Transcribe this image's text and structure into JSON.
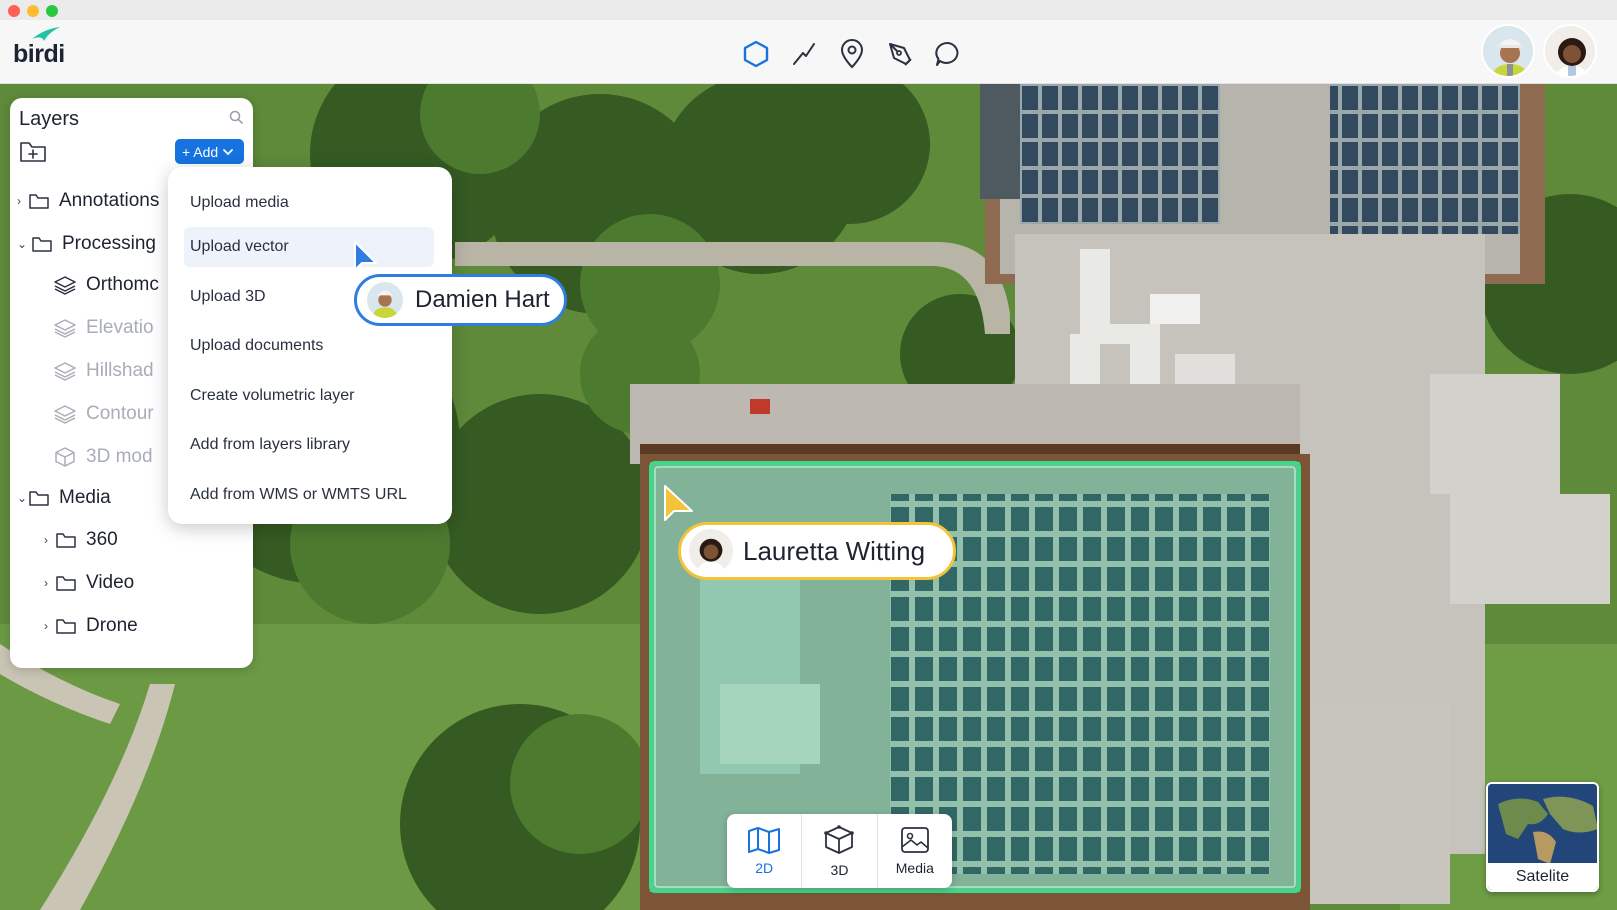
{
  "app": {
    "logo_text": "birdi"
  },
  "toolbar": {
    "tools": [
      {
        "name": "polygon-tool",
        "icon": "hexagon-icon",
        "active": true
      },
      {
        "name": "line-tool",
        "icon": "line-icon"
      },
      {
        "name": "pin-tool",
        "icon": "map-pin-icon"
      },
      {
        "name": "draw-tool",
        "icon": "pen-icon"
      },
      {
        "name": "comment-tool",
        "icon": "speech-bubble-icon"
      }
    ]
  },
  "layers": {
    "title": "Layers",
    "add_label": "+ Add",
    "items": [
      {
        "label": "Annotations",
        "icon": "folder-icon"
      },
      {
        "label": "Processing",
        "icon": "folder-icon"
      },
      {
        "label": "Orthomc",
        "icon": "layers-icon"
      },
      {
        "label": "Elevatio",
        "icon": "layers-icon"
      },
      {
        "label": "Hillshad",
        "icon": "layers-icon"
      },
      {
        "label": "Contour",
        "icon": "layers-icon"
      },
      {
        "label": "3D mod",
        "icon": "cube-icon"
      },
      {
        "label": "Media",
        "icon": "folder-icon"
      },
      {
        "label": "360",
        "icon": "folder-icon"
      },
      {
        "label": "Video",
        "icon": "folder-icon"
      },
      {
        "label": "Drone",
        "icon": "folder-icon"
      }
    ]
  },
  "add_menu": {
    "items": [
      "Upload media",
      "Upload vector",
      "Upload 3D",
      "Upload documents",
      "Create volumetric layer",
      "Add from layers library",
      "Add from WMS or WMTS URL"
    ]
  },
  "collaborators": {
    "user1": {
      "name": "Damien Hart",
      "color": "#2f7de1"
    },
    "user2": {
      "name": "Lauretta Witting",
      "color": "#f3c33a"
    }
  },
  "views": {
    "items": [
      "2D",
      "3D",
      "Media"
    ]
  },
  "basemap": {
    "label": "Satelite"
  },
  "colors": {
    "accent": "#1673e0",
    "selection": "#3bd98a"
  }
}
